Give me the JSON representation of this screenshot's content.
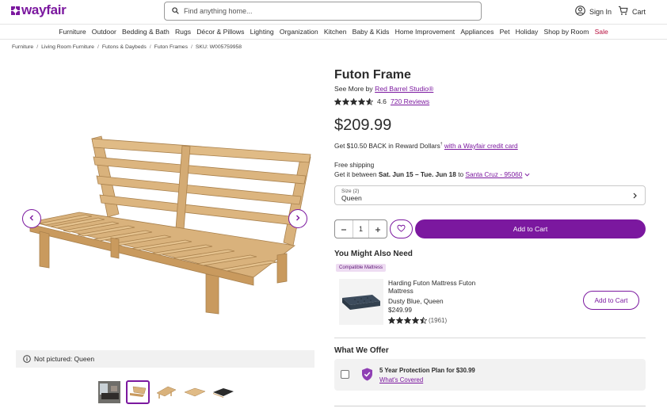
{
  "header": {
    "logo_text": "wayfair",
    "search_placeholder": "Find anything home...",
    "signin_label": "Sign In",
    "cart_label": "Cart"
  },
  "nav": {
    "items": [
      "Furniture",
      "Outdoor",
      "Bedding & Bath",
      "Rugs",
      "Décor & Pillows",
      "Lighting",
      "Organization",
      "Kitchen",
      "Baby & Kids",
      "Home Improvement",
      "Appliances",
      "Pet",
      "Holiday",
      "Shop by Room",
      "Sale"
    ]
  },
  "breadcrumb": {
    "items": [
      "Furniture",
      "Living Room Furniture",
      "Futons & Daybeds",
      "Futon Frames"
    ],
    "sku": "SKU: W005759958"
  },
  "gallery": {
    "not_pictured": "Not pictured: Queen",
    "thumbnail_count": 5,
    "active_thumbnail": 2
  },
  "product": {
    "title": "Futon Frame",
    "see_more_prefix": "See More by",
    "brand": "Red Barrel Studio®",
    "rating": "4.6",
    "rating_value": 4.6,
    "reviews": "720 Reviews",
    "price": "$209.99",
    "reward_prefix": "Get $10.50 BACK in Reward Dollars",
    "reward_sup": "†",
    "reward_link": "with a Wayfair credit card",
    "shipping": "Free shipping",
    "delivery_prefix": "Get it between",
    "delivery_dates": "Sat. Jun 15 – Tue. Jun 18",
    "delivery_to": "to",
    "delivery_location": "Santa Cruz - 95060",
    "size_key": "Size (2)",
    "size_value": "Queen",
    "quantity": "1",
    "add_to_cart": "Add to Cart"
  },
  "recommendations": {
    "heading": "You Might Also Need",
    "badge": "Compatible Mattress",
    "item": {
      "name": "Harding Futon Mattress Futon Mattress",
      "variant": "Dusty Blue, Queen",
      "price": "$249.99",
      "rating_value": 4.5,
      "reviews": "(1961)",
      "add_label": "Add to Cart"
    }
  },
  "offer": {
    "heading": "What We Offer",
    "plan": "5 Year Protection Plan for $30.99",
    "link": "What's Covered"
  },
  "colors": {
    "brand": "#7b189f",
    "sale": "#b8103f",
    "wood": "#d9b27c"
  }
}
